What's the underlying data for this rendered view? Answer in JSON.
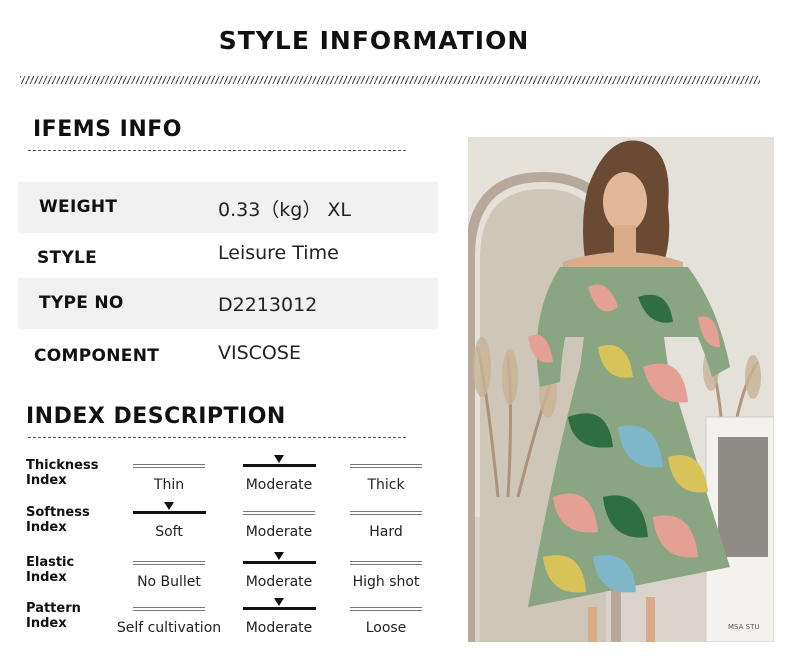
{
  "page_title": "STYLE INFORMATION",
  "items_info": {
    "heading": "IFEMS INFO",
    "rows": [
      {
        "label": "WEIGHT",
        "value": "0.33（kg） XL"
      },
      {
        "label": "STYLE",
        "value": "Leisure Time"
      },
      {
        "label": "TYPE NO",
        "value": "D2213012"
      },
      {
        "label": "COMPONENT",
        "value": "VISCOSE"
      }
    ]
  },
  "index_description": {
    "heading": "INDEX DESCRIPTION",
    "indexes": [
      {
        "label_line1": "Thickness",
        "label_line2": "Index",
        "options": [
          "Thin",
          "Moderate",
          "Thick"
        ],
        "selected": 1
      },
      {
        "label_line1": "Softness",
        "label_line2": "Index",
        "options": [
          "Soft",
          "Moderate",
          "Hard"
        ],
        "selected": 0
      },
      {
        "label_line1": "Elastic",
        "label_line2": "Index",
        "options": [
          "No Bullet",
          "Moderate",
          "High shot"
        ],
        "selected": 1
      },
      {
        "label_line1": "Pattern",
        "label_line2": "Index",
        "options": [
          "Self cultivation",
          "Moderate",
          "Loose"
        ],
        "selected": 1
      }
    ]
  },
  "photo": {
    "frame_text": "MSA STU",
    "palette": {
      "dress_base": "#8aa582",
      "leaf_pink": "#e3a093",
      "leaf_green": "#2f6e3e",
      "leaf_yellow": "#d8c35a",
      "leaf_blue": "#7fb6c9",
      "wall": "#e7e3dd"
    }
  }
}
